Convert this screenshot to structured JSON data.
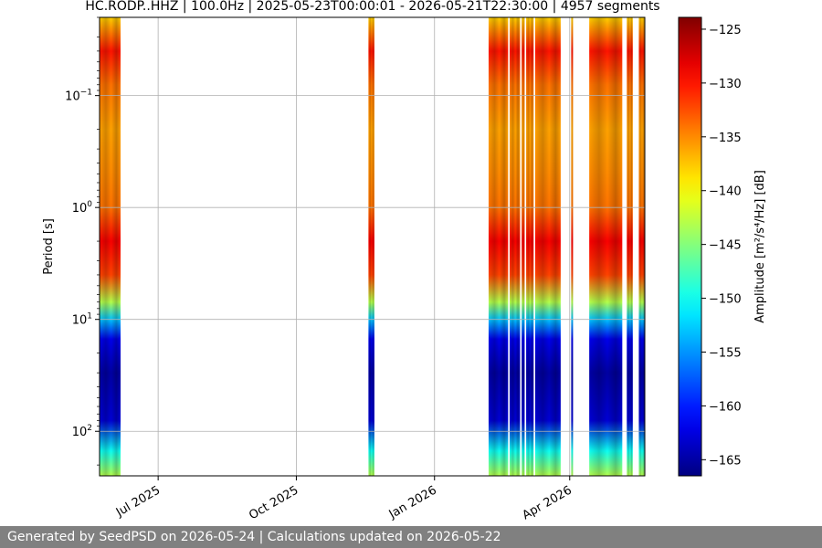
{
  "chart_data": {
    "type": "heatmap",
    "title": "HC.RODP..HHZ | 100.0Hz | 2025-05-23T00:00:01 - 2026-05-21T22:30:00 | 4957 segments",
    "xlabel": "",
    "ylabel": "Period [s]",
    "x_range": [
      "2025-05-23",
      "2026-05-21"
    ],
    "x_ticks": [
      {
        "date": "2025-07-01",
        "label": "Jul 2025"
      },
      {
        "date": "2025-10-01",
        "label": "Oct 2025"
      },
      {
        "date": "2026-01-01",
        "label": "Jan 2026"
      },
      {
        "date": "2026-04-01",
        "label": "Apr 2026"
      }
    ],
    "y_scale": "log",
    "y_inverted": true,
    "y_range": [
      0.02,
      250
    ],
    "y_ticks": [
      {
        "value": 0.1,
        "base": "10",
        "exp": "−1"
      },
      {
        "value": 1,
        "base": "10",
        "exp": "0"
      },
      {
        "value": 10,
        "base": "10",
        "exp": "1"
      },
      {
        "value": 100,
        "base": "10",
        "exp": "2"
      }
    ],
    "grid": true,
    "colorbar": {
      "label": "Amplitude [m²/s⁴/Hz] [dB]",
      "colormap": "jet",
      "range": [
        -166.5,
        -123.9
      ],
      "ticks": [
        -125,
        -130,
        -135,
        -140,
        -145,
        -150,
        -155,
        -160,
        -165
      ]
    },
    "data_periods": [
      {
        "start": "2025-05-23",
        "end": "2025-06-06"
      },
      {
        "start": "2025-11-18",
        "end": "2025-11-22"
      },
      {
        "start": "2026-02-06",
        "end": "2026-02-19"
      },
      {
        "start": "2026-02-20",
        "end": "2026-02-27"
      },
      {
        "start": "2026-02-28",
        "end": "2026-03-02"
      },
      {
        "start": "2026-03-03",
        "end": "2026-03-08"
      },
      {
        "start": "2026-03-09",
        "end": "2026-03-26"
      },
      {
        "start": "2026-04-02",
        "end": "2026-04-03"
      },
      {
        "start": "2026-04-14",
        "end": "2026-05-06"
      },
      {
        "start": "2026-05-09",
        "end": "2026-05-13"
      },
      {
        "start": "2026-05-17",
        "end": "2026-05-21"
      }
    ],
    "amplitude_profile_db": [
      {
        "period_s": 0.02,
        "db": -138
      },
      {
        "period_s": 0.04,
        "db": -130
      },
      {
        "period_s": 0.08,
        "db": -134
      },
      {
        "period_s": 0.2,
        "db": -136
      },
      {
        "period_s": 0.5,
        "db": -135
      },
      {
        "period_s": 1,
        "db": -134
      },
      {
        "period_s": 2,
        "db": -129
      },
      {
        "period_s": 4,
        "db": -132
      },
      {
        "period_s": 7,
        "db": -143
      },
      {
        "period_s": 10,
        "db": -153
      },
      {
        "period_s": 15,
        "db": -162
      },
      {
        "period_s": 30,
        "db": -165
      },
      {
        "period_s": 80,
        "db": -163
      },
      {
        "period_s": 150,
        "db": -150
      },
      {
        "period_s": 250,
        "db": -143
      }
    ]
  },
  "footer": {
    "text": "Generated by SeedPSD on 2026-05-24 | Calculations updated on 2026-05-22"
  }
}
